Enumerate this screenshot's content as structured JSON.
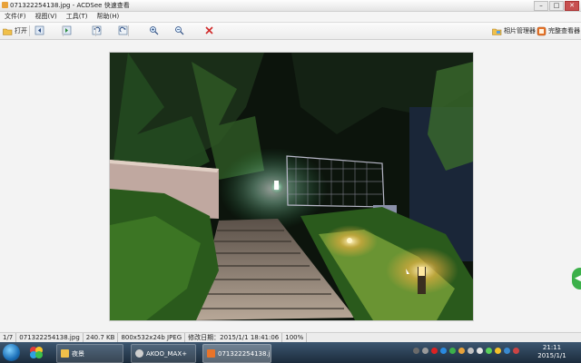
{
  "window": {
    "title": "071322254138.jpg - ACDSee 快速查看",
    "controls": [
      "–",
      "□",
      "✕"
    ]
  },
  "menu": [
    "文件(F)",
    "视图(V)",
    "工具(T)",
    "帮助(H)"
  ],
  "toolbar": {
    "open_label": "打开",
    "photo_manager_label": "相片管理器",
    "full_viewer_label": "完整查看器"
  },
  "status": {
    "index": "1/7",
    "filename": "071322254138.jpg",
    "size": "240.7 KB",
    "dims": "800x532x24b JPEG",
    "modified": "修改日期：2015/1/1 18:41:06",
    "zoom": "100%"
  },
  "taskbar": {
    "items": [
      "夜景",
      "AKOO_MAX+",
      "071322254138.j..."
    ],
    "clock_time": "21:11",
    "clock_date": "2015/1/1"
  },
  "colors": {
    "accent": "#3cb04a",
    "close": "#c75050",
    "taskbar": "#1c2c3c"
  }
}
